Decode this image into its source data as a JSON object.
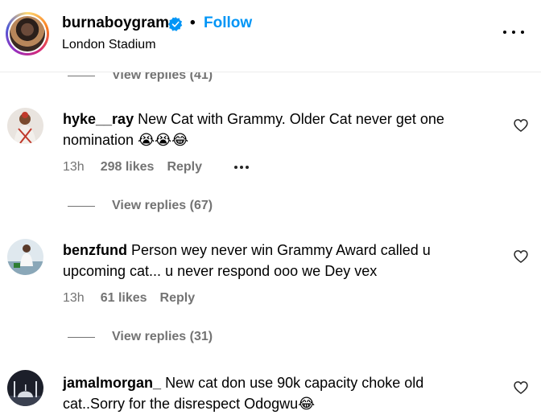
{
  "post_header": {
    "username": "burnaboygram",
    "separator": "•",
    "follow_label": "Follow",
    "location": "London Stadium"
  },
  "replies_top": {
    "label": "View replies (41)"
  },
  "comments": [
    {
      "username": "hyke__ray",
      "text": "New Cat with Grammy. Older Cat never get one nomination",
      "emojis": "😭😭😂",
      "time": "13h",
      "likes": "298 likes",
      "reply_label": "Reply",
      "view_replies": "View replies (67)"
    },
    {
      "username": "benzfund",
      "text": "Person wey never win Grammy Award called u upcoming cat... u never respond ooo we Dey vex",
      "emojis": "",
      "time": "13h",
      "likes": "61 likes",
      "reply_label": "Reply",
      "view_replies": "View replies (31)"
    },
    {
      "username": "jamalmorgan_",
      "text": "New cat don use 90k capacity choke old cat..Sorry for the disrespect Odogwu",
      "emojis": "😂",
      "time": "",
      "likes": "",
      "reply_label": "",
      "view_replies": ""
    }
  ],
  "icons": {
    "verified": "verified-badge-icon",
    "more": "more-options-icon",
    "like": "heart-icon",
    "comment_options": "ellipsis-icon"
  },
  "colors": {
    "link_blue": "#0095f6",
    "muted_gray": "#737373",
    "verified_blue": "#0095f6"
  }
}
